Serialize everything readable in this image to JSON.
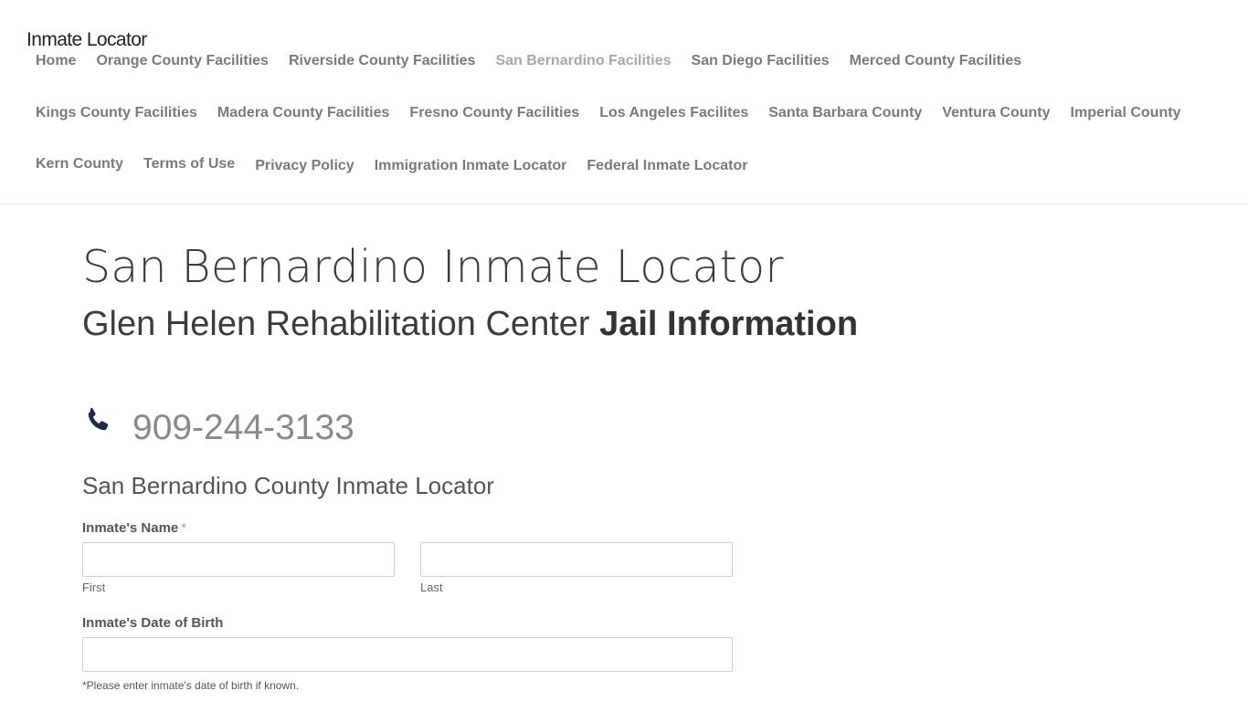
{
  "header": {
    "site_title": "Inmate Locator",
    "nav": [
      {
        "label": "Home"
      },
      {
        "label": "Orange County Facilities"
      },
      {
        "label": "Riverside County Facilities"
      },
      {
        "label": "San Bernardino Facilities"
      },
      {
        "label": "San Diego Facilities"
      },
      {
        "label": "Merced County Facilities"
      },
      {
        "label": "Kings County Facilities"
      },
      {
        "label": "Madera County Facilities"
      },
      {
        "label": "Fresno County Facilities"
      },
      {
        "label": "Los Angeles Facilites"
      },
      {
        "label": "Santa Barbara County"
      },
      {
        "label": "Ventura County"
      },
      {
        "label": "Imperial County"
      },
      {
        "label": "Kern County"
      },
      {
        "label": "Terms of Use"
      },
      {
        "label": "Privacy Policy"
      },
      {
        "label": "Immigration Inmate Locator"
      },
      {
        "label": "Federal Inmate Locator"
      }
    ],
    "active_nav": "San Bernardino Facilities"
  },
  "main": {
    "page_title": "San Bernardino Inmate Locator",
    "subtitle_light": "Glen Helen Rehabilitation Center",
    "subtitle_bold": "Jail Information",
    "phone": "909-244-3133",
    "form": {
      "title": "San Bernardino County Inmate Locator",
      "name_label": "Inmate's Name",
      "required_mark": "*",
      "first_value": "",
      "last_value": "",
      "first_sublabel": "First",
      "last_sublabel": "Last",
      "dob_label": "Inmate's Date of Birth",
      "dob_value": "",
      "dob_note": "*Please enter inmate's date of birth if known."
    }
  },
  "colors": {
    "nav_text": "#7a7a7a",
    "nav_active": "#a8a8a8",
    "phone_icon": "#1d2a4d"
  }
}
